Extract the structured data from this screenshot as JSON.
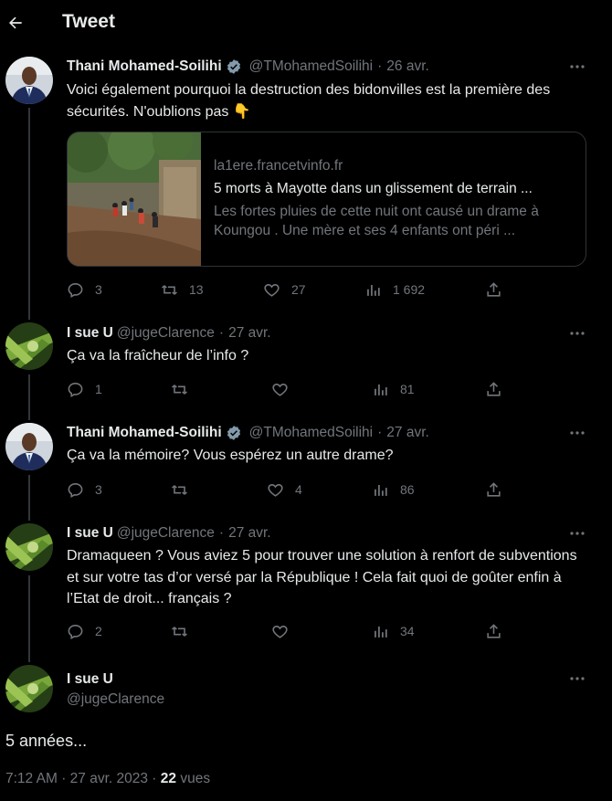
{
  "header": {
    "title": "Tweet",
    "back_icon": "arrow-left-icon"
  },
  "tweets": [
    {
      "name": "Thani Mohamed-Soilihi",
      "verified": true,
      "handle": "@TMohamedSoilihi",
      "date": "26 avr.",
      "text": "Voici également pourquoi la destruction des bidonvilles est la première des sécurités. N'oublions pas 👇",
      "card": {
        "domain": "la1ere.francetvinfo.fr",
        "title": "5 morts à Mayotte dans un glissement de terrain ...",
        "description": "Les fortes pluies de cette nuit ont causé un drame à Koungou . Une mère et ses 4 enfants ont péri ..."
      },
      "replies": "3",
      "retweets": "13",
      "likes": "27",
      "views": "1 692"
    },
    {
      "name": "I sue U",
      "verified": false,
      "handle": "@jugeClarence",
      "date": "27 avr.",
      "text": "Ça va la fraîcheur de l’info ?",
      "replies": "1",
      "retweets": "",
      "likes": "",
      "views": "81"
    },
    {
      "name": "Thani Mohamed-Soilihi",
      "verified": true,
      "handle": "@TMohamedSoilihi",
      "date": "27 avr.",
      "text": "Ça va la mémoire? Vous espérez un autre drame?",
      "replies": "3",
      "retweets": "",
      "likes": "4",
      "views": "86"
    },
    {
      "name": "I sue U",
      "verified": false,
      "handle": "@jugeClarence",
      "date": "27 avr.",
      "text": "Dramaqueen ? Vous aviez 5 pour trouver une solution à renfort de subventions et sur votre tas d’or versé par la République ! Cela fait quoi de goûter enfin à l’Etat de droit... français ?",
      "replies": "2",
      "retweets": "",
      "likes": "",
      "views": "34"
    }
  ],
  "focus": {
    "name": "I sue U",
    "handle": "@jugeClarence",
    "text": "5 années...",
    "time": "7:12 AM",
    "date": "27 avr. 2023",
    "views_count": "22",
    "views_label": "vues"
  },
  "colors": {
    "background": "#000000",
    "text": "#e7e9ea",
    "muted": "#71767b",
    "verified": "#829aab",
    "divider": "#2f3336"
  }
}
